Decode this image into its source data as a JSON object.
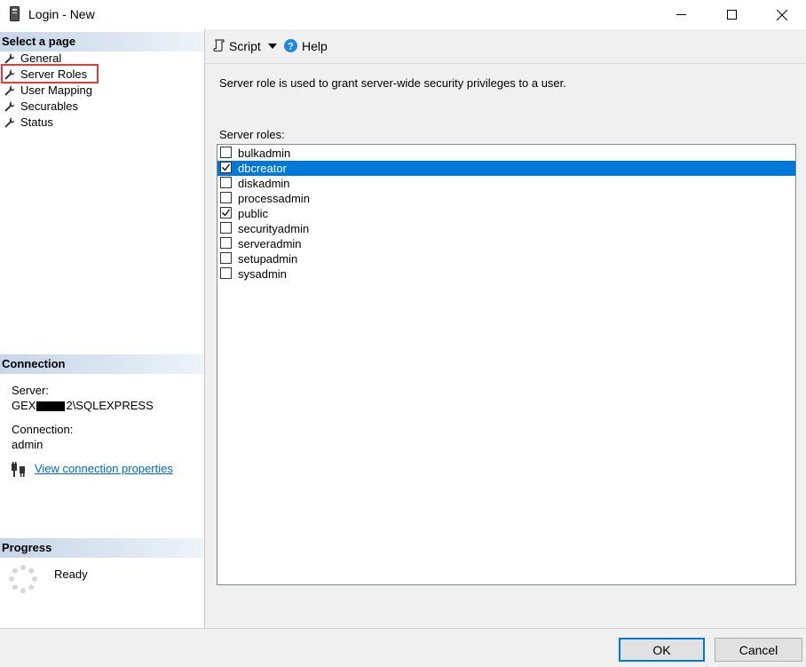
{
  "window": {
    "title": "Login - New"
  },
  "left_pane": {
    "select_page_header": "Select a page",
    "pages": [
      {
        "label": "General",
        "selected": false
      },
      {
        "label": "Server Roles",
        "selected": true
      },
      {
        "label": "User Mapping",
        "selected": false
      },
      {
        "label": "Securables",
        "selected": false
      },
      {
        "label": "Status",
        "selected": false
      }
    ],
    "connection_header": "Connection",
    "server_label": "Server:",
    "server_value_prefix": "GEX",
    "server_value_suffix": "2\\SQLEXPRESS",
    "connection_label": "Connection:",
    "connection_value": "admin",
    "view_connection_link": "View connection properties",
    "progress_header": "Progress",
    "progress_status": "Ready"
  },
  "toolbar": {
    "script_label": "Script",
    "help_label": "Help"
  },
  "main": {
    "description": "Server role is used to grant server-wide security privileges to a user.",
    "roles_label": "Server roles:",
    "roles": [
      {
        "name": "bulkadmin",
        "checked": false,
        "selected": false
      },
      {
        "name": "dbcreator",
        "checked": true,
        "selected": true
      },
      {
        "name": "diskadmin",
        "checked": false,
        "selected": false
      },
      {
        "name": "processadmin",
        "checked": false,
        "selected": false
      },
      {
        "name": "public",
        "checked": true,
        "selected": false
      },
      {
        "name": "securityadmin",
        "checked": false,
        "selected": false
      },
      {
        "name": "serveradmin",
        "checked": false,
        "selected": false
      },
      {
        "name": "setupadmin",
        "checked": false,
        "selected": false
      },
      {
        "name": "sysadmin",
        "checked": false,
        "selected": false
      }
    ]
  },
  "buttons": {
    "ok_label": "OK",
    "cancel_label": "Cancel"
  },
  "colors": {
    "selection": "#0078d7",
    "link": "#0066cc",
    "highlight_border": "#e03c3c"
  }
}
